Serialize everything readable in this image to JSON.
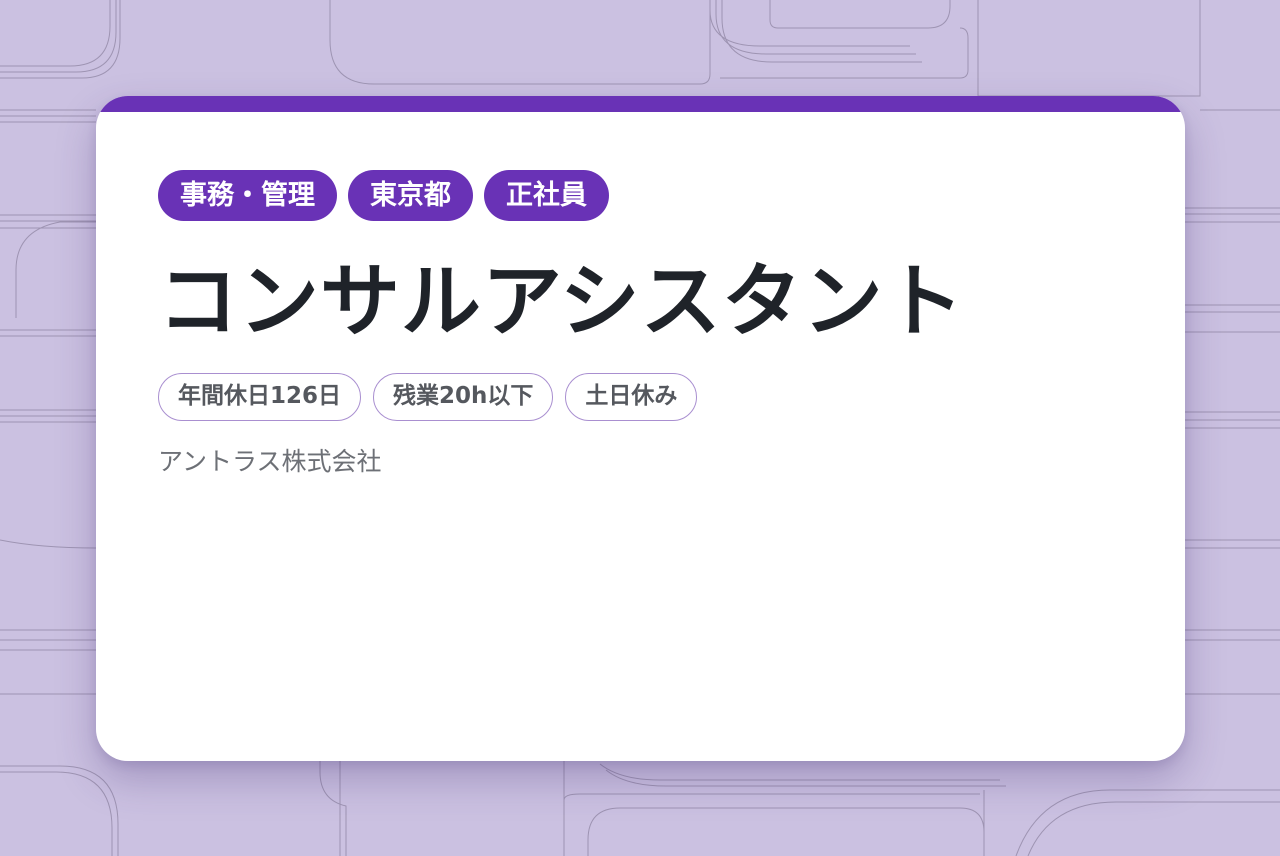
{
  "job": {
    "category_tags": [
      "事務・管理",
      "東京都",
      "正社員"
    ],
    "title": "コンサルアシスタント",
    "feature_tags": [
      "年間休日126日",
      "残業20h以下",
      "土日休み"
    ],
    "company": "アントラス株式会社"
  },
  "colors": {
    "background": "#cbc1e1",
    "accent": "#6932b6",
    "title_text": "#1f2329",
    "muted_text": "#6d7076",
    "tag_border": "#a98fd0"
  }
}
